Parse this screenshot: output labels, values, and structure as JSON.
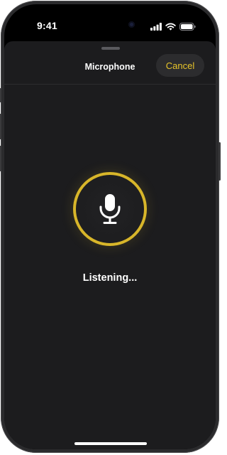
{
  "status_bar": {
    "time": "9:41",
    "icons": [
      "cellular-signal-icon",
      "wifi-icon",
      "battery-icon"
    ]
  },
  "sheet": {
    "title": "Microphone",
    "cancel_label": "Cancel"
  },
  "mic": {
    "icon": "microphone-icon",
    "status_text": "Listening..."
  },
  "colors": {
    "accent": "#d8b62a",
    "cancel_text": "#e7c42a",
    "sheet_background": "#1c1c1e",
    "screen_background": "#000000"
  }
}
